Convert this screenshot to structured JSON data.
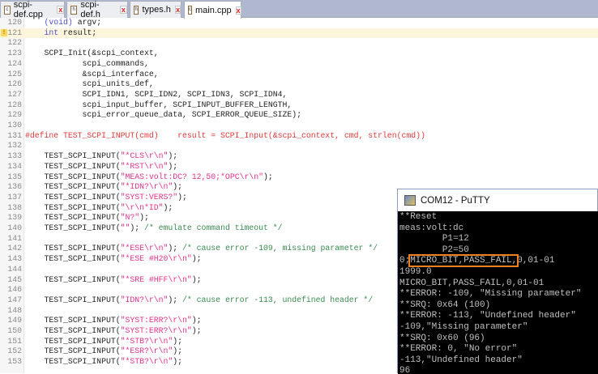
{
  "tabs": [
    {
      "label": "scpi-def.cpp",
      "icon": "c-file-icon",
      "active": false
    },
    {
      "label": "scpi-def.h",
      "icon": "h-file-icon",
      "active": false
    },
    {
      "label": "types.h",
      "icon": "h-file-icon",
      "active": false
    },
    {
      "label": "main.cpp",
      "icon": "c-file-icon",
      "active": true
    }
  ],
  "editor": {
    "highlighted_line": "121",
    "warning_line": "121",
    "colors": {
      "keyword": "#5050d0",
      "string": "#e0308a",
      "comment": "#3a8a50",
      "macro": "#e03838"
    },
    "lines": [
      {
        "n": "120",
        "seg": [
          [
            "    ",
            ""
          ],
          [
            "(void)",
            "kw"
          ],
          [
            " argv;",
            ""
          ]
        ]
      },
      {
        "n": "121",
        "seg": [
          [
            "    ",
            ""
          ],
          [
            "int",
            "kw"
          ],
          [
            " result;",
            ""
          ]
        ]
      },
      {
        "n": "122",
        "seg": []
      },
      {
        "n": "123",
        "seg": [
          [
            "    SCPI_Init(&scpi_context,",
            ""
          ]
        ]
      },
      {
        "n": "124",
        "seg": [
          [
            "            scpi_commands,",
            ""
          ]
        ]
      },
      {
        "n": "125",
        "seg": [
          [
            "            &scpi_interface,",
            ""
          ]
        ]
      },
      {
        "n": "126",
        "seg": [
          [
            "            scpi_units_def,",
            ""
          ]
        ]
      },
      {
        "n": "127",
        "seg": [
          [
            "            SCPI_IDN1, SCPI_IDN2, SCPI_IDN3, SCPI_IDN4,",
            ""
          ]
        ]
      },
      {
        "n": "128",
        "seg": [
          [
            "            scpi_input_buffer, SCPI_INPUT_BUFFER_LENGTH,",
            ""
          ]
        ]
      },
      {
        "n": "129",
        "seg": [
          [
            "            scpi_error_queue_data, SCPI_ERROR_QUEUE_SIZE);",
            ""
          ]
        ]
      },
      {
        "n": "130",
        "seg": []
      },
      {
        "n": "131",
        "seg": [
          [
            "#define TEST_SCPI_INPUT(cmd)    result = SCPI_Input(&scpi_context, cmd, strlen(cmd))",
            "def"
          ]
        ]
      },
      {
        "n": "132",
        "seg": []
      },
      {
        "n": "133",
        "seg": [
          [
            "    TEST_SCPI_INPUT(",
            ""
          ],
          [
            "\"*CLS\\r\\n\"",
            "str"
          ],
          [
            ");",
            ""
          ]
        ]
      },
      {
        "n": "134",
        "seg": [
          [
            "    TEST_SCPI_INPUT(",
            ""
          ],
          [
            "\"*RST\\r\\n\"",
            "str"
          ],
          [
            ");",
            ""
          ]
        ]
      },
      {
        "n": "135",
        "seg": [
          [
            "    TEST_SCPI_INPUT(",
            ""
          ],
          [
            "\"MEAS:volt:DC? 12,50;*OPC\\r\\n\"",
            "str"
          ],
          [
            ");",
            ""
          ]
        ]
      },
      {
        "n": "136",
        "seg": [
          [
            "    TEST_SCPI_INPUT(",
            ""
          ],
          [
            "\"*IDN?\\r\\n\"",
            "str"
          ],
          [
            ");",
            ""
          ]
        ]
      },
      {
        "n": "137",
        "seg": [
          [
            "    TEST_SCPI_INPUT(",
            ""
          ],
          [
            "\"SYST:VERS?\"",
            "str"
          ],
          [
            ");",
            ""
          ]
        ]
      },
      {
        "n": "138",
        "seg": [
          [
            "    TEST_SCPI_INPUT(",
            ""
          ],
          [
            "\"\\r\\n*ID\"",
            "str"
          ],
          [
            ");",
            ""
          ]
        ]
      },
      {
        "n": "139",
        "seg": [
          [
            "    TEST_SCPI_INPUT(",
            ""
          ],
          [
            "\"N?\"",
            "str"
          ],
          [
            ");",
            ""
          ]
        ]
      },
      {
        "n": "140",
        "seg": [
          [
            "    TEST_SCPI_INPUT(",
            ""
          ],
          [
            "\"\"",
            "str"
          ],
          [
            "); ",
            ""
          ],
          [
            "/* emulate command timeout */",
            "cm"
          ]
        ]
      },
      {
        "n": "141",
        "seg": []
      },
      {
        "n": "142",
        "seg": [
          [
            "    TEST_SCPI_INPUT(",
            ""
          ],
          [
            "\"*ESE\\r\\n\"",
            "str"
          ],
          [
            "); ",
            ""
          ],
          [
            "/* cause error -109, missing parameter */",
            "cm"
          ]
        ]
      },
      {
        "n": "143",
        "seg": [
          [
            "    TEST_SCPI_INPUT(",
            ""
          ],
          [
            "\"*ESE #H20\\r\\n\"",
            "str"
          ],
          [
            ");",
            ""
          ]
        ]
      },
      {
        "n": "144",
        "seg": []
      },
      {
        "n": "145",
        "seg": [
          [
            "    TEST_SCPI_INPUT(",
            ""
          ],
          [
            "\"*SRE #HFF\\r\\n\"",
            "str"
          ],
          [
            ");",
            ""
          ]
        ]
      },
      {
        "n": "146",
        "seg": []
      },
      {
        "n": "147",
        "seg": [
          [
            "    TEST_SCPI_INPUT(",
            ""
          ],
          [
            "\"IDN?\\r\\n\"",
            "str"
          ],
          [
            "); ",
            ""
          ],
          [
            "/* cause error -113, undefined header */",
            "cm"
          ]
        ]
      },
      {
        "n": "148",
        "seg": []
      },
      {
        "n": "149",
        "seg": [
          [
            "    TEST_SCPI_INPUT(",
            ""
          ],
          [
            "\"SYST:ERR?\\r\\n\"",
            "str"
          ],
          [
            ");",
            ""
          ]
        ]
      },
      {
        "n": "150",
        "seg": [
          [
            "    TEST_SCPI_INPUT(",
            ""
          ],
          [
            "\"SYST:ERR?\\r\\n\"",
            "str"
          ],
          [
            ");",
            ""
          ]
        ]
      },
      {
        "n": "151",
        "seg": [
          [
            "    TEST_SCPI_INPUT(",
            ""
          ],
          [
            "\"*STB?\\r\\n\"",
            "str"
          ],
          [
            ");",
            ""
          ]
        ]
      },
      {
        "n": "152",
        "seg": [
          [
            "    TEST_SCPI_INPUT(",
            ""
          ],
          [
            "\"*ESR?\\r\\n\"",
            "str"
          ],
          [
            ");",
            ""
          ]
        ]
      },
      {
        "n": "153",
        "seg": [
          [
            "    TEST_SCPI_INPUT(",
            ""
          ],
          [
            "\"*STB?\\r\\n\"",
            "str"
          ],
          [
            ");",
            ""
          ]
        ]
      }
    ]
  },
  "putty": {
    "title": "COM12 - PuTTY",
    "highlight_color": "#f08020",
    "lines": [
      "**Reset",
      "meas:volt:dc",
      "        P1=12",
      "        P2=50",
      {
        "pre": "0;",
        "box": "MICRO_BIT,PASS_FAIL,",
        "post": "0,01-01"
      },
      "1999.0",
      "MICRO_BIT,PASS_FAIL,0,01-01",
      "**ERROR: -109, \"Missing parameter\"",
      "**SRQ: 0x64 (100)",
      "**ERROR: -113, \"Undefined header\"",
      "-109,\"Missing parameter\"",
      "**SRQ: 0x60 (96)",
      "**ERROR: 0, \"No error\"",
      "-113,\"Undefined header\"",
      "96"
    ]
  }
}
